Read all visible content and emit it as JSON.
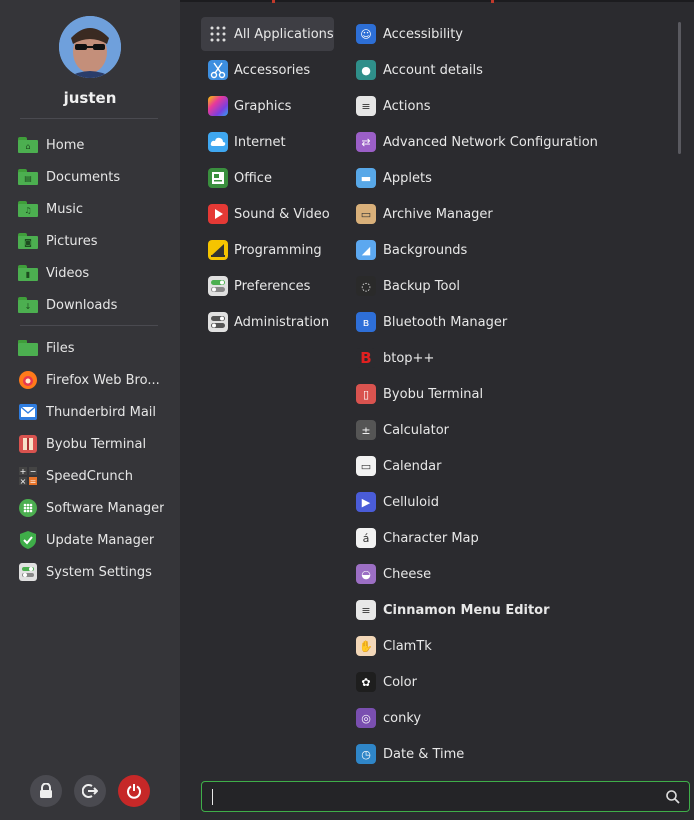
{
  "user": {
    "name": "justen"
  },
  "favorites": [
    {
      "label": "Home",
      "icon": "home-folder-icon",
      "glyph": "⌂"
    },
    {
      "label": "Documents",
      "icon": "documents-folder-icon",
      "glyph": "▤"
    },
    {
      "label": "Music",
      "icon": "music-folder-icon",
      "glyph": "♫"
    },
    {
      "label": "Pictures",
      "icon": "pictures-folder-icon",
      "glyph": "◙"
    },
    {
      "label": "Videos",
      "icon": "videos-folder-icon",
      "glyph": "▮"
    },
    {
      "label": "Downloads",
      "icon": "downloads-folder-icon",
      "glyph": "↓"
    }
  ],
  "pinned_apps": [
    {
      "label": "Files",
      "icon": "files-icon"
    },
    {
      "label": "Firefox Web Bro...",
      "icon": "firefox-icon"
    },
    {
      "label": "Thunderbird Mail",
      "icon": "thunderbird-icon"
    },
    {
      "label": "Byobu Terminal",
      "icon": "byobu-icon"
    },
    {
      "label": "SpeedCrunch",
      "icon": "speedcrunch-icon"
    },
    {
      "label": "Software Manager",
      "icon": "software-manager-icon"
    },
    {
      "label": "Update Manager",
      "icon": "update-manager-icon"
    },
    {
      "label": "System Settings",
      "icon": "system-settings-icon"
    }
  ],
  "system_buttons": {
    "lock": "lock-icon",
    "logout": "logout-icon",
    "power": "power-icon"
  },
  "categories": [
    {
      "label": "All Applications",
      "icon": "grid-icon",
      "color": "#3e3e44",
      "active": true
    },
    {
      "label": "Accessories",
      "icon": "scissors-icon",
      "color": "#3d8fe0"
    },
    {
      "label": "Graphics",
      "icon": "palette-icon",
      "color": "#e040a0"
    },
    {
      "label": "Internet",
      "icon": "cloud-icon",
      "color": "#3fa7f0"
    },
    {
      "label": "Office",
      "icon": "office-icon",
      "color": "#3a8f3e"
    },
    {
      "label": "Sound & Video",
      "icon": "play-icon",
      "color": "#e53935"
    },
    {
      "label": "Programming",
      "icon": "programming-icon",
      "color": "#f5c400"
    },
    {
      "label": "Preferences",
      "icon": "toggles-icon",
      "color": "#dcdcdc"
    },
    {
      "label": "Administration",
      "icon": "admin-toggles-icon",
      "color": "#dcdcdc"
    }
  ],
  "applications": [
    {
      "label": "Accessibility",
      "icon": "accessibility-icon",
      "color": "#2d6fd6",
      "glyph": "☺"
    },
    {
      "label": "Account details",
      "icon": "account-icon",
      "color": "#2f8f8a",
      "glyph": "●"
    },
    {
      "label": "Actions",
      "icon": "actions-icon",
      "color": "#e6e6e6",
      "glyph": "≡"
    },
    {
      "label": "Advanced Network Configuration",
      "icon": "network-icon",
      "color": "#9b5fc7",
      "glyph": "⇄"
    },
    {
      "label": "Applets",
      "icon": "applets-icon",
      "color": "#58a8e8",
      "glyph": "▬"
    },
    {
      "label": "Archive Manager",
      "icon": "archive-icon",
      "color": "#d9b07a",
      "glyph": "▭"
    },
    {
      "label": "Backgrounds",
      "icon": "backgrounds-icon",
      "color": "#5ca8f0",
      "glyph": "◢"
    },
    {
      "label": "Backup Tool",
      "icon": "backup-icon",
      "color": "#2a2a2a",
      "glyph": "◌"
    },
    {
      "label": "Bluetooth Manager",
      "icon": "bluetooth-icon",
      "color": "#2e6fd8",
      "glyph": "ʙ"
    },
    {
      "label": "btop++",
      "icon": "btop-icon",
      "color": "#2b2b2f",
      "glyph": "B"
    },
    {
      "label": "Byobu Terminal",
      "icon": "byobu-terminal-icon",
      "color": "#d9534f",
      "glyph": "▯"
    },
    {
      "label": "Calculator",
      "icon": "calculator-icon",
      "color": "#555555",
      "glyph": "±"
    },
    {
      "label": "Calendar",
      "icon": "calendar-icon",
      "color": "#f2f2f2",
      "glyph": "▭"
    },
    {
      "label": "Celluloid",
      "icon": "celluloid-icon",
      "color": "#4a5cd8",
      "glyph": "▶"
    },
    {
      "label": "Character Map",
      "icon": "character-map-icon",
      "color": "#f2f2f2",
      "glyph": "á"
    },
    {
      "label": "Cheese",
      "icon": "cheese-icon",
      "color": "#9c6fc4",
      "glyph": "◒"
    },
    {
      "label": "Cinnamon Menu Editor",
      "icon": "menu-editor-icon",
      "color": "#e8e8e8",
      "glyph": "≡",
      "bold": true
    },
    {
      "label": "ClamTk",
      "icon": "clamtk-icon",
      "color": "#f2d7b8",
      "glyph": "✋"
    },
    {
      "label": "Color",
      "icon": "color-icon",
      "color": "#1e1e1e",
      "glyph": "✿"
    },
    {
      "label": "conky",
      "icon": "conky-icon",
      "color": "#7a4fb0",
      "glyph": "◎"
    },
    {
      "label": "Date & Time",
      "icon": "clock-icon",
      "color": "#2f86c8",
      "glyph": "◷"
    }
  ],
  "search": {
    "value": "",
    "placeholder": ""
  }
}
